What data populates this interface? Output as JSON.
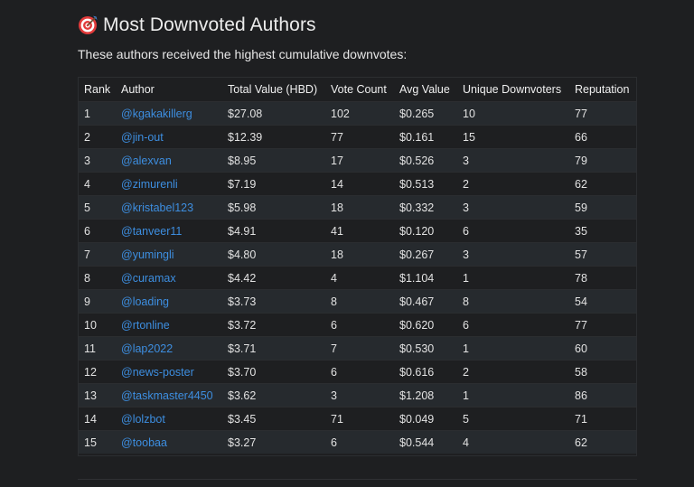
{
  "page": {
    "title": "Most Downvoted Authors",
    "title_icon": "direct-hit-target-icon",
    "intro": "These authors received the highest cumulative downvotes:"
  },
  "table": {
    "headers": [
      "Rank",
      "Author",
      "Total Value (HBD)",
      "Vote Count",
      "Avg Value",
      "Unique Downvoters",
      "Reputation"
    ],
    "rows": [
      {
        "rank": "1",
        "author": "@kgakakillerg",
        "total": "$27.08",
        "votes": "102",
        "avg": "$0.265",
        "unique": "10",
        "rep": "77"
      },
      {
        "rank": "2",
        "author": "@jin-out",
        "total": "$12.39",
        "votes": "77",
        "avg": "$0.161",
        "unique": "15",
        "rep": "66"
      },
      {
        "rank": "3",
        "author": "@alexvan",
        "total": "$8.95",
        "votes": "17",
        "avg": "$0.526",
        "unique": "3",
        "rep": "79"
      },
      {
        "rank": "4",
        "author": "@zimurenli",
        "total": "$7.19",
        "votes": "14",
        "avg": "$0.513",
        "unique": "2",
        "rep": "62"
      },
      {
        "rank": "5",
        "author": "@kristabel123",
        "total": "$5.98",
        "votes": "18",
        "avg": "$0.332",
        "unique": "3",
        "rep": "59"
      },
      {
        "rank": "6",
        "author": "@tanveer11",
        "total": "$4.91",
        "votes": "41",
        "avg": "$0.120",
        "unique": "6",
        "rep": "35"
      },
      {
        "rank": "7",
        "author": "@yumingli",
        "total": "$4.80",
        "votes": "18",
        "avg": "$0.267",
        "unique": "3",
        "rep": "57"
      },
      {
        "rank": "8",
        "author": "@curamax",
        "total": "$4.42",
        "votes": "4",
        "avg": "$1.104",
        "unique": "1",
        "rep": "78"
      },
      {
        "rank": "9",
        "author": "@loading",
        "total": "$3.73",
        "votes": "8",
        "avg": "$0.467",
        "unique": "8",
        "rep": "54"
      },
      {
        "rank": "10",
        "author": "@rtonline",
        "total": "$3.72",
        "votes": "6",
        "avg": "$0.620",
        "unique": "6",
        "rep": "77"
      },
      {
        "rank": "11",
        "author": "@lap2022",
        "total": "$3.71",
        "votes": "7",
        "avg": "$0.530",
        "unique": "1",
        "rep": "60"
      },
      {
        "rank": "12",
        "author": "@news-poster",
        "total": "$3.70",
        "votes": "6",
        "avg": "$0.616",
        "unique": "2",
        "rep": "58"
      },
      {
        "rank": "13",
        "author": "@taskmaster4450",
        "total": "$3.62",
        "votes": "3",
        "avg": "$1.208",
        "unique": "1",
        "rep": "86"
      },
      {
        "rank": "14",
        "author": "@lolzbot",
        "total": "$3.45",
        "votes": "71",
        "avg": "$0.049",
        "unique": "5",
        "rep": "71"
      },
      {
        "rank": "15",
        "author": "@toobaa",
        "total": "$3.27",
        "votes": "6",
        "avg": "$0.544",
        "unique": "4",
        "rep": "62"
      }
    ]
  },
  "colors": {
    "background": "#1e1f21",
    "row_stripe": "#262a2e",
    "link": "#3d8ee0",
    "text": "#e6e6e6"
  }
}
